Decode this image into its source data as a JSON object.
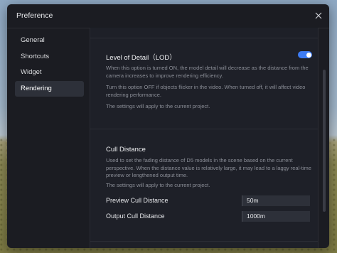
{
  "window": {
    "title": "Preference"
  },
  "sidebar": {
    "items": [
      {
        "label": "General"
      },
      {
        "label": "Shortcuts"
      },
      {
        "label": "Widget"
      },
      {
        "label": "Rendering",
        "active": true
      }
    ]
  },
  "lod": {
    "title": "Level of Detail（LOD）",
    "enabled": true,
    "desc1": "When this option is turned ON, the model detail will decrease as the distance from the camera increases to improve rendering efficiency.",
    "desc2": "Turn this option OFF if objects flicker in the video. When turned off, it will affect video rendering performance.",
    "desc3": "The settings will apply to the current project."
  },
  "cull": {
    "title": "Cull Distance",
    "desc1": "Used to set the fading distance of D5 models in the scene based on the current perspective. When the distance value is relatively large, it may lead to a laggy real-time preview or lengthened output time.",
    "desc2": "The settings will apply to the current project.",
    "preview_label": "Preview Cull Distance",
    "preview_value": "50m",
    "output_label": "Output Cull Distance",
    "output_value": "1000m"
  },
  "colors": {
    "accent": "#3d7cf5",
    "panel": "#1b1c22"
  }
}
